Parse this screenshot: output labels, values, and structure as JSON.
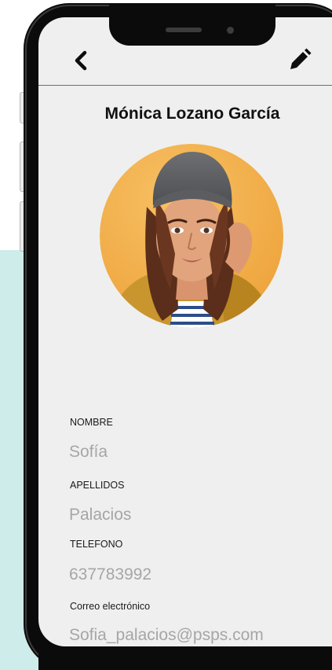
{
  "header": {
    "back_icon": "chevron-left-icon",
    "edit_icon": "pencil-icon"
  },
  "contact": {
    "full_name": "Mónica Lozano García",
    "avatar_icon": "profile-photo"
  },
  "fields": [
    {
      "label": "NOMBRE",
      "value": "Sofía"
    },
    {
      "label": "APELLIDOS",
      "value": "Palacios"
    },
    {
      "label": "TELEFONO",
      "value": "637783992"
    },
    {
      "label": "Correo electrónico",
      "value": "Sofia_palacios@psps.com"
    }
  ],
  "colors": {
    "screen_bg": "#efefef",
    "phone_frame": "#0b0b0b",
    "teal_panel": "#cdecea",
    "avatar_bg": "#f2b04a",
    "value_text": "#a6a6a6"
  }
}
